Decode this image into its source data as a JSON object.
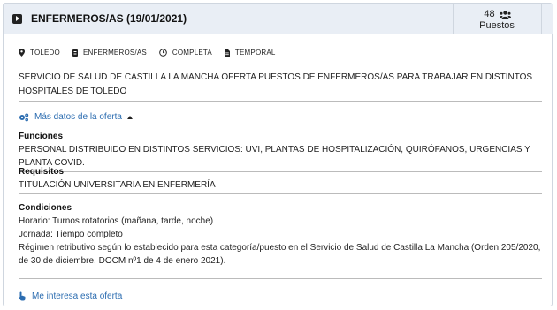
{
  "header": {
    "title": "ENFERMEROS/AS (19/01/2021)",
    "puestos_count": "48",
    "puestos_label": "Puestos"
  },
  "meta": {
    "location": "TOLEDO",
    "category": "ENFERMEROS/AS",
    "schedule": "COMPLETA",
    "contract": "TEMPORAL"
  },
  "description": "SERVICIO DE SALUD DE CASTILLA LA MANCHA OFERTA PUESTOS DE ENFERMEROS/AS PARA TRABAJAR EN DISTINTOS HOSPITALES DE TOLEDO",
  "more_data": {
    "label": "Más datos de la oferta"
  },
  "funciones": {
    "heading": "Funciones",
    "text": "PERSONAL DISTRIBUIDO EN DISTINTOS SERVICIOS: UVI, PLANTAS DE HOSPITALIZACIÓN, QUIRÓFANOS, URGENCIAS Y PLANTA COVID."
  },
  "requisitos": {
    "heading": "Requisitos",
    "text": "TITULACIÓN UNIVERSITARIA EN ENFERMERÍA"
  },
  "condiciones": {
    "heading": "Condiciones",
    "lines": [
      "Horario: Turnos rotatorios (mañana, tarde, noche)",
      "Jornada: Tiempo completo",
      "Régimen retributivo según lo establecido para esta categoría/puesto en  el Servicio de Salud de Castilla La Mancha (Orden 205/2020, de 30 de diciembre, DOCM nº1 de 4 de enero 2021)."
    ]
  },
  "interest": {
    "label": "Me interesa esta oferta"
  },
  "colors": {
    "link": "#2b6cb0",
    "header_bg": "#e9eef5"
  }
}
